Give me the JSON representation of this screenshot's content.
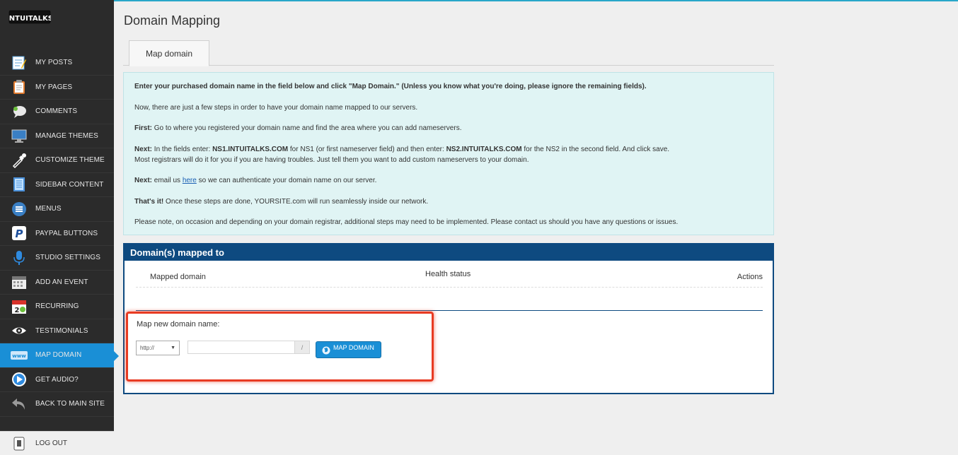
{
  "app": {
    "logo_text": "INTUITALKS"
  },
  "sidebar": {
    "items": [
      {
        "label": "MY POSTS",
        "icon": "notepad-icon"
      },
      {
        "label": "MY PAGES",
        "icon": "clipboard-icon"
      },
      {
        "label": "COMMENTS",
        "icon": "speech-bubble-icon"
      },
      {
        "label": "MANAGE THEMES",
        "icon": "monitor-icon"
      },
      {
        "label": "CUSTOMIZE THEME",
        "icon": "eyedropper-icon"
      },
      {
        "label": "SIDEBAR CONTENT",
        "icon": "sidebar-document-icon"
      },
      {
        "label": "MENUS",
        "icon": "menu-list-icon"
      },
      {
        "label": "PAYPAL BUTTONS",
        "icon": "paypal-icon"
      },
      {
        "label": "STUDIO SETTINGS",
        "icon": "microphone-icon"
      },
      {
        "label": "ADD AN EVENT",
        "icon": "calendar-icon"
      },
      {
        "label": "RECURRING",
        "icon": "recurring-calendar-icon"
      },
      {
        "label": "TESTIMONIALS",
        "icon": "eye-icon"
      },
      {
        "label": "MAP DOMAIN",
        "icon": "www-icon",
        "active": true
      },
      {
        "label": "GET AUDIO?",
        "icon": "play-icon"
      },
      {
        "label": "BACK TO MAIN SITE",
        "icon": "back-arrow-icon"
      }
    ],
    "logout": {
      "label": "LOG OUT",
      "icon": "logout-icon"
    }
  },
  "main": {
    "title": "Domain Mapping",
    "tabs": [
      {
        "label": "Map domain"
      }
    ],
    "info": {
      "intro": "Enter your purchased domain name in the field below and click \"Map Domain.\" (Unless you know what you're doing, please ignore the remaining fields).",
      "steps": "Now, there are just a few steps in order to have your domain name mapped to our servers.",
      "first_label": "First:",
      "first_text": " Go to where you registered your domain name and find the area where you can add nameservers.",
      "next1_label": "Next:",
      "next1_a": " In the fields enter: ",
      "ns1": "NS1.INTUITALKS.COM",
      "next1_b": " for NS1 (or first nameserver field) and then enter: ",
      "ns2": "NS2.INTUITALKS.COM",
      "next1_c": " for the NS2 in the second field. And click save.",
      "next1_line2": "Most registrars will do it for you if you are having troubles. Just tell them you want to add custom nameservers to your domain.",
      "next2_label": "Next:",
      "next2_a": " email us ",
      "next2_link": "here",
      "next2_b": " so we can authenticate your domain name on our server.",
      "done_label": "That's it!",
      "done_text": " Once these steps are done, YOURSITE.com will run seamlessly inside our network.",
      "note": "Please note, on occasion and depending on your domain registrar, additional steps may need to be implemented. Please contact us should you have any questions or issues."
    },
    "mapped": {
      "header": "Domain(s) mapped to",
      "columns": [
        "Mapped domain",
        "Health status",
        "Actions"
      ],
      "map_new_label": "Map new domain name:",
      "protocol": "http://",
      "domain_value": "",
      "slash": "/",
      "button_label": "MAP DOMAIN"
    }
  },
  "colors": {
    "accent": "#1a8fd6",
    "navy": "#0e4a80",
    "highlight": "#e83b23",
    "info_bg": "#e0f4f4"
  }
}
